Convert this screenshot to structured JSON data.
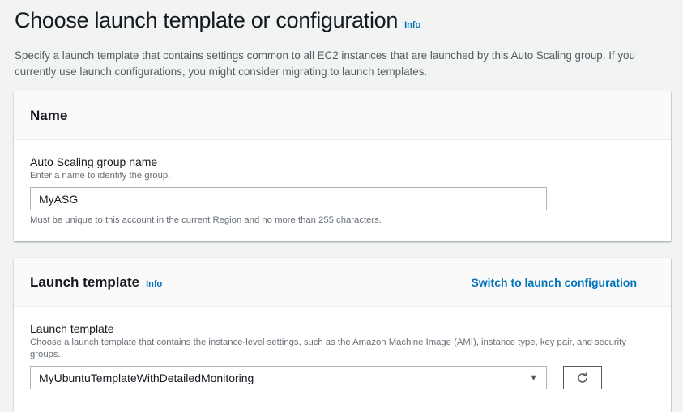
{
  "header": {
    "title": "Choose launch template or configuration",
    "info": "Info",
    "description": "Specify a launch template that contains settings common to all EC2 instances that are launched by this Auto Scaling group. If you currently use launch configurations, you might consider migrating to launch templates."
  },
  "name_section": {
    "title": "Name",
    "field_label": "Auto Scaling group name",
    "field_hint": "Enter a name to identify the group.",
    "field_value": "MyASG",
    "field_note": "Must be unique to this account in the current Region and no more than 255 characters."
  },
  "launch_template_section": {
    "title": "Launch template",
    "info": "Info",
    "switch_link": "Switch to launch configuration",
    "field_label": "Launch template",
    "field_hint": "Choose a launch template that contains the instance-level settings, such as the Amazon Machine Image (AMI), instance type, key pair, and security groups.",
    "selected_value": "MyUbuntuTemplateWithDetailedMonitoring"
  }
}
